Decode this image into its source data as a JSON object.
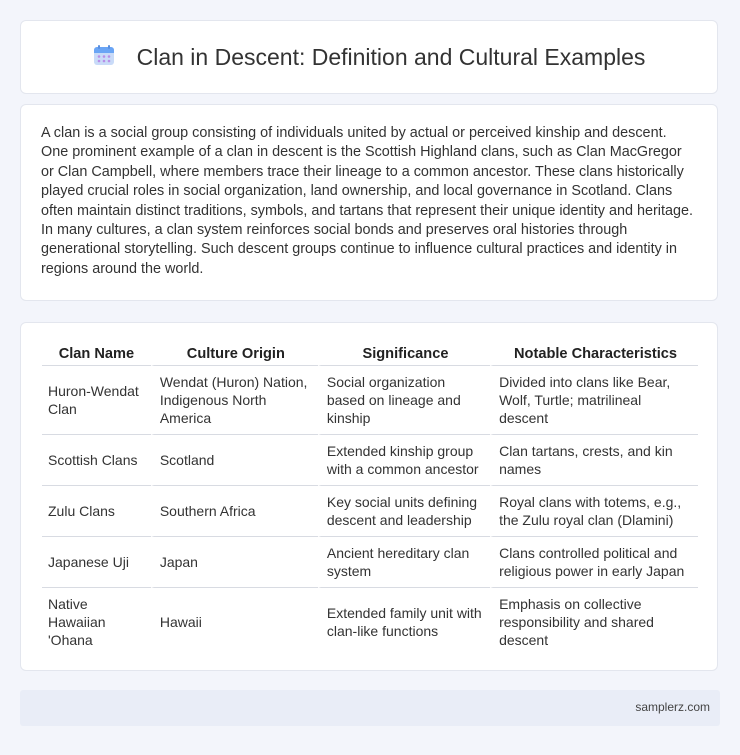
{
  "header": {
    "title": "Clan in Descent: Definition and Cultural Examples",
    "icon": "calendar-icon",
    "icon_colors": {
      "top": "#6aa5f5",
      "body": "#c4d7f8",
      "dots": "#b78ee8"
    }
  },
  "intro": {
    "text": "A clan is a social group consisting of individuals united by actual or perceived kinship and descent. One prominent example of a clan in descent is the Scottish Highland clans, such as Clan MacGregor or Clan Campbell, where members trace their lineage to a common ancestor. These clans historically played crucial roles in social organization, land ownership, and local governance in Scotland. Clans often maintain distinct traditions, symbols, and tartans that represent their unique identity and heritage. In many cultures, a clan system reinforces social bonds and preserves oral histories through generational storytelling. Such descent groups continue to influence cultural practices and identity in regions around the world."
  },
  "table": {
    "headers": [
      "Clan Name",
      "Culture Origin",
      "Significance",
      "Notable Characteristics"
    ],
    "rows": [
      [
        "Huron-Wendat Clan",
        "Wendat (Huron) Nation, Indigenous North America",
        "Social organization based on lineage and kinship",
        "Divided into clans like Bear, Wolf, Turtle; matrilineal descent"
      ],
      [
        "Scottish Clans",
        "Scotland",
        "Extended kinship group with a common ancestor",
        "Clan tartans, crests, and kin names"
      ],
      [
        "Zulu Clans",
        "Southern Africa",
        "Key social units defining descent and leadership",
        "Royal clans with totems, e.g., the Zulu royal clan (Dlamini)"
      ],
      [
        "Japanese Uji",
        "Japan",
        "Ancient hereditary clan system",
        "Clans controlled political and religious power in early Japan"
      ],
      [
        "Native Hawaiian 'Ohana",
        "Hawaii",
        "Extended family unit with clan-like functions",
        "Emphasis on collective responsibility and shared descent"
      ]
    ]
  },
  "footer": {
    "site": "samplerz.com"
  }
}
